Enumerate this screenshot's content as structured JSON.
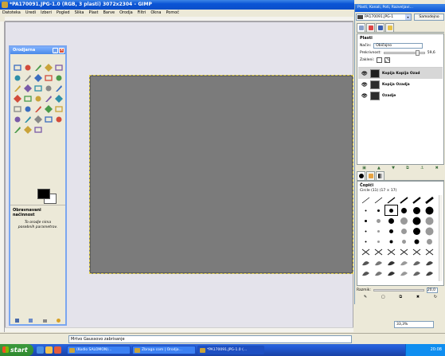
{
  "main_window": {
    "title": "*PA170091.JPG-1.0 (RGB, 3 plasti) 3072x2304 – GIMP",
    "menu": [
      "Datoteka",
      "Uredi",
      "Izberi",
      "Pogled",
      "Slika",
      "Plast",
      "Barve",
      "Orodja",
      "Filtri",
      "Okna",
      "Pomoč"
    ],
    "status_text": "Mrtvo Gaussovo zabrisanje"
  },
  "toolbox": {
    "title": "Orodjarna",
    "tools": [
      "rect-select-icon",
      "ellipse-select-icon",
      "free-select-icon",
      "fuzzy-select-icon",
      "color-select-icon",
      "scissors-icon",
      "foreground-select-icon",
      "paths-icon",
      "color-picker-icon",
      "zoom-icon",
      "measure-icon",
      "move-icon",
      "align-icon",
      "crop-icon",
      "rotate-icon",
      "scale-icon",
      "shear-icon",
      "perspective-icon",
      "flip-icon",
      "text-icon",
      "bucket-fill-icon",
      "blend-icon",
      "pencil-icon",
      "paintbrush-icon",
      "eraser-icon",
      "airbrush-icon",
      "ink-icon",
      "clone-icon",
      "heal-icon",
      "perspective-clone-icon",
      "blur-icon",
      "smudge-icon",
      "dodge-burn-icon"
    ],
    "foreground_color": "#000000",
    "background_color": "#ffffff",
    "tool_options_title": "Obravnavani načinnost",
    "tool_options_text": "To orodje nima\nposebnih parametrov."
  },
  "dock": {
    "title": "Plasti, Kanali, Poti, Razveljavi…",
    "image_selector": "PA170091.JPG-1",
    "auto_button": "Samodejno",
    "layers": {
      "title": "Plasti",
      "mode_label": "Način:",
      "mode_value": "Običajno",
      "opacity_label": "Prekrivnost:",
      "opacity_value": "59,6",
      "lock_label": "Zakleni:",
      "items": [
        {
          "name": "Kopija Kopija Ozad",
          "visible": true,
          "selected": true
        },
        {
          "name": "Kopija Ozadja",
          "visible": true,
          "selected": false
        },
        {
          "name": "Ozadje",
          "visible": true,
          "selected": false
        }
      ]
    },
    "brushes": {
      "title": "Čopiči",
      "subtitle": "Circle (11) (17 × 17)",
      "spacing_label": "Razmik:",
      "spacing_value": "20,0"
    }
  },
  "zoom": "33,3%",
  "taskbar": {
    "start_label": "start",
    "tasks": [
      "(Kodlo SALOMON)…",
      "Zbraga com | Orodja…",
      "*PA170091.JPG-1.0 (…"
    ],
    "clock": "20:08"
  },
  "colors": {
    "titlebar": "#0a54d6",
    "canvas_bg": "#e4e3eb",
    "image": "#7b7b7b",
    "selection": "#e6d34a",
    "taskbar": "#245edb",
    "start": "#2f8a2f"
  }
}
